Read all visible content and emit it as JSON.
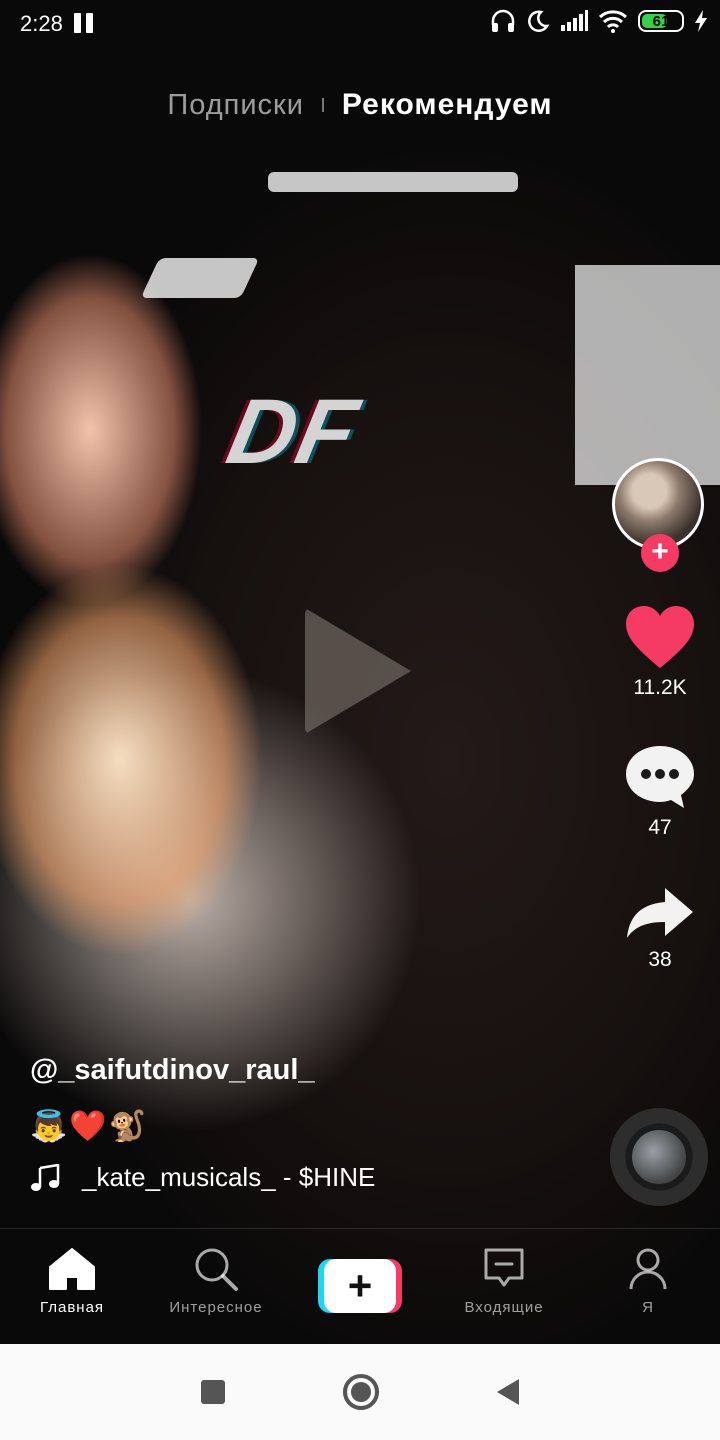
{
  "status_bar": {
    "time": "2:28",
    "battery": "61"
  },
  "top_tabs": {
    "following": "Подписки",
    "for_you": "Рекомендуем"
  },
  "video": {
    "overlay_text": "DF"
  },
  "side_actions": {
    "likes": "11.2K",
    "comments": "47",
    "shares": "38"
  },
  "caption": {
    "username": "@_saifutdinov_raul_",
    "text": "👼❤️🐒",
    "music": "_kate_musicals_ - $HINE"
  },
  "bottom_nav": {
    "home": "Главная",
    "discover": "Интересное",
    "create": "+",
    "inbox": "Входящие",
    "me": "Я"
  },
  "colors": {
    "like": "#f53a63",
    "create_left": "#20d5ec",
    "create_right": "#f53a63"
  },
  "icons": [
    "pause-icon",
    "headphones-icon",
    "moon-icon",
    "signal-icon",
    "wifi-icon",
    "battery-icon",
    "charging-icon",
    "play-icon",
    "heart-icon",
    "comment-icon",
    "share-icon",
    "music-note-icon",
    "home-icon",
    "search-icon",
    "inbox-icon",
    "profile-icon"
  ]
}
